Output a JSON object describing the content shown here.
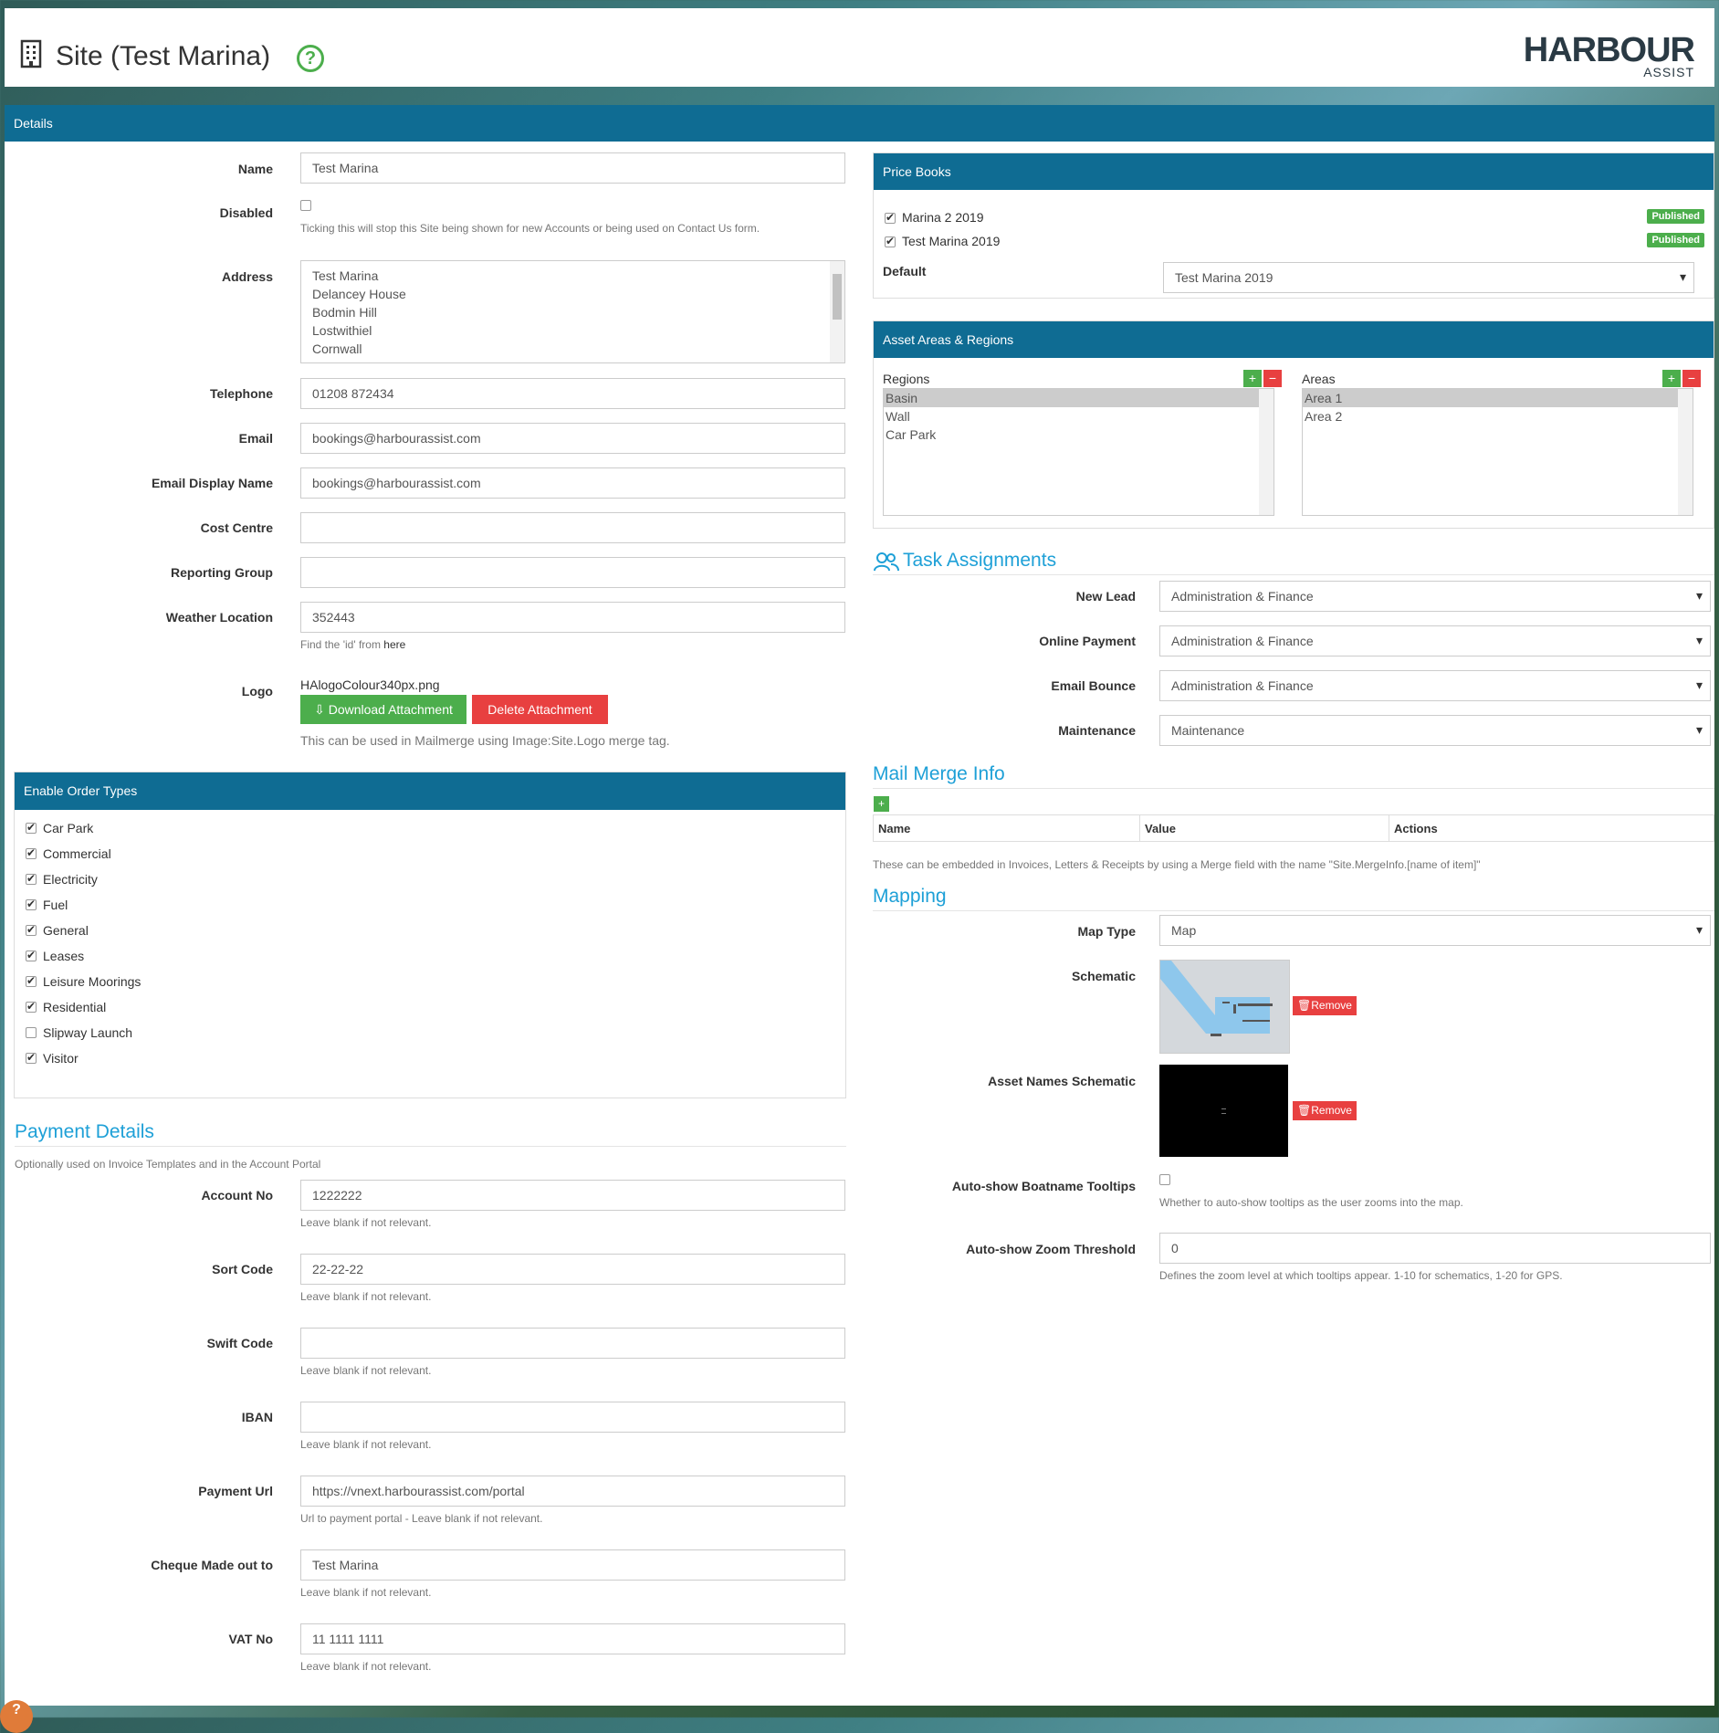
{
  "header": {
    "title": "Site (Test Marina)",
    "help": "?",
    "logo_main": "HARBOUR",
    "logo_sub": "ASSIST"
  },
  "details": {
    "bar": "Details",
    "name_label": "Name",
    "name_value": "Test Marina",
    "disabled_label": "Disabled",
    "disabled_hint": "Ticking this will stop this Site being shown for new Accounts or being used on Contact Us form.",
    "address_label": "Address",
    "address_lines": [
      "Test Marina",
      "Delancey House",
      "Bodmin Hill",
      "Lostwithiel",
      "Cornwall"
    ],
    "telephone_label": "Telephone",
    "telephone_value": "01208 872434",
    "email_label": "Email",
    "email_value": "bookings@harbourassist.com",
    "email_display_label": "Email Display Name",
    "email_display_value": "bookings@harbourassist.com",
    "cost_centre_label": "Cost Centre",
    "cost_centre_value": "",
    "reporting_group_label": "Reporting Group",
    "reporting_group_value": "",
    "weather_label": "Weather Location",
    "weather_value": "352443",
    "weather_hint": "Find the 'id' from",
    "weather_link": "here",
    "logo_label": "Logo",
    "logo_file": "HAlogoColour340px.png",
    "download_button": "Download Attachment",
    "delete_button": "Delete Attachment",
    "logo_hint": "This can be used in Mailmerge using Image:Site.Logo merge tag."
  },
  "order_types": {
    "bar": "Enable Order Types",
    "items": [
      {
        "label": "Car Park",
        "checked": true
      },
      {
        "label": "Commercial",
        "checked": true
      },
      {
        "label": "Electricity",
        "checked": true
      },
      {
        "label": "Fuel",
        "checked": true
      },
      {
        "label": "General",
        "checked": true
      },
      {
        "label": "Leases",
        "checked": true
      },
      {
        "label": "Leisure Moorings",
        "checked": true
      },
      {
        "label": "Residential",
        "checked": true
      },
      {
        "label": "Slipway Launch",
        "checked": false
      },
      {
        "label": "Visitor",
        "checked": true
      }
    ]
  },
  "payment": {
    "heading": "Payment Details",
    "sub": "Optionally used on Invoice Templates and in the Account Portal",
    "blank_hint": "Leave blank if not relevant.",
    "fields": [
      {
        "label": "Account No",
        "value": "1222222",
        "hint": "Leave blank if not relevant."
      },
      {
        "label": "Sort Code",
        "value": "22-22-22",
        "hint": "Leave blank if not relevant."
      },
      {
        "label": "Swift Code",
        "value": "",
        "hint": "Leave blank if not relevant."
      },
      {
        "label": "IBAN",
        "value": "",
        "hint": "Leave blank if not relevant."
      },
      {
        "label": "Payment Url",
        "value": "https://vnext.harbourassist.com/portal",
        "hint": "Url to payment portal - Leave blank if not relevant."
      },
      {
        "label": "Cheque Made out to",
        "value": "Test Marina",
        "hint": "Leave blank if not relevant."
      },
      {
        "label": "VAT No",
        "value": "11 1111 1111",
        "hint": "Leave blank if not relevant."
      }
    ]
  },
  "price_books": {
    "bar": "Price Books",
    "items": [
      {
        "label": "Marina 2 2019",
        "status": "Published"
      },
      {
        "label": "Test Marina 2019",
        "status": "Published"
      }
    ],
    "default_label": "Default",
    "default_value": "Test Marina 2019"
  },
  "asset_areas": {
    "bar": "Asset Areas & Regions",
    "regions_label": "Regions",
    "regions": [
      "Basin",
      "Wall",
      "Car Park"
    ],
    "areas_label": "Areas",
    "areas": [
      "Area 1",
      "Area 2"
    ],
    "add": "+",
    "remove": "−"
  },
  "tasks": {
    "heading": "Task Assignments",
    "rows": [
      {
        "label": "New Lead",
        "value": "Administration & Finance"
      },
      {
        "label": "Online Payment",
        "value": "Administration & Finance"
      },
      {
        "label": "Email Bounce",
        "value": "Administration & Finance"
      },
      {
        "label": "Maintenance",
        "value": "Maintenance"
      }
    ]
  },
  "mail_merge": {
    "heading": "Mail Merge Info",
    "add": "+",
    "columns": [
      "Name",
      "Value",
      "Actions"
    ],
    "hint": "These can be embedded in Invoices, Letters & Receipts by using a Merge field with the name \"Site.MergeInfo.[name of item]\""
  },
  "mapping": {
    "heading": "Mapping",
    "map_type_label": "Map Type",
    "map_type_value": "Map",
    "schematic_label": "Schematic",
    "remove": "Remove",
    "asset_names_label": "Asset Names Schematic",
    "tooltips_label": "Auto-show Boatname Tooltips",
    "tooltips_hint": "Whether to auto-show tooltips as the user zooms into the map.",
    "zoom_label": "Auto-show Zoom Threshold",
    "zoom_value": "0",
    "zoom_hint": "Defines the zoom level at which tooltips appear. 1-10 for schematics, 1-20 for GPS."
  },
  "colors": {
    "bar": "#0f6c93",
    "accent": "#1ea0d7",
    "green": "#4cae4c",
    "red": "#e84040"
  }
}
